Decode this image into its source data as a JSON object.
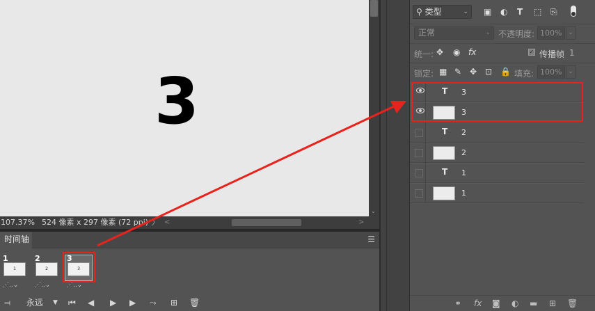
{
  "canvas": {
    "digit": "3"
  },
  "statusbar": {
    "zoom": "107.37%",
    "info": "524 像素 x 297 像素 (72 ppi)",
    "arrow": "〉"
  },
  "timeline": {
    "tab": "时间轴",
    "frames": [
      {
        "number": "1",
        "thumb_label": "1",
        "delay": "⋰..⌄"
      },
      {
        "number": "2",
        "thumb_label": "2",
        "delay": "⋰..⌄"
      },
      {
        "number": "3",
        "thumb_label": "3",
        "delay": "⋰..⌄"
      }
    ],
    "loop": "永远"
  },
  "layers_panel": {
    "filter": {
      "kind_label": "类型"
    },
    "blend_mode": "正常",
    "opacity_label": "不透明度:",
    "opacity_value": "100%",
    "unify_label": "统一:",
    "propagate_label": "传播帧",
    "propagate_value": "1",
    "lock_label": "锁定:",
    "fill_label": "填充:",
    "fill_value": "100%",
    "layers": [
      {
        "type": "text",
        "name": "3",
        "visible": true
      },
      {
        "type": "raster",
        "name": "3",
        "visible": true
      },
      {
        "type": "text",
        "name": "2",
        "visible": false
      },
      {
        "type": "raster",
        "name": "2",
        "visible": false
      },
      {
        "type": "text",
        "name": "1",
        "visible": false
      },
      {
        "type": "raster",
        "name": "1",
        "visible": false
      }
    ]
  },
  "colors": {
    "highlight": "#e8231d",
    "panel": "#535353",
    "canvas": "#e8e8e8"
  }
}
